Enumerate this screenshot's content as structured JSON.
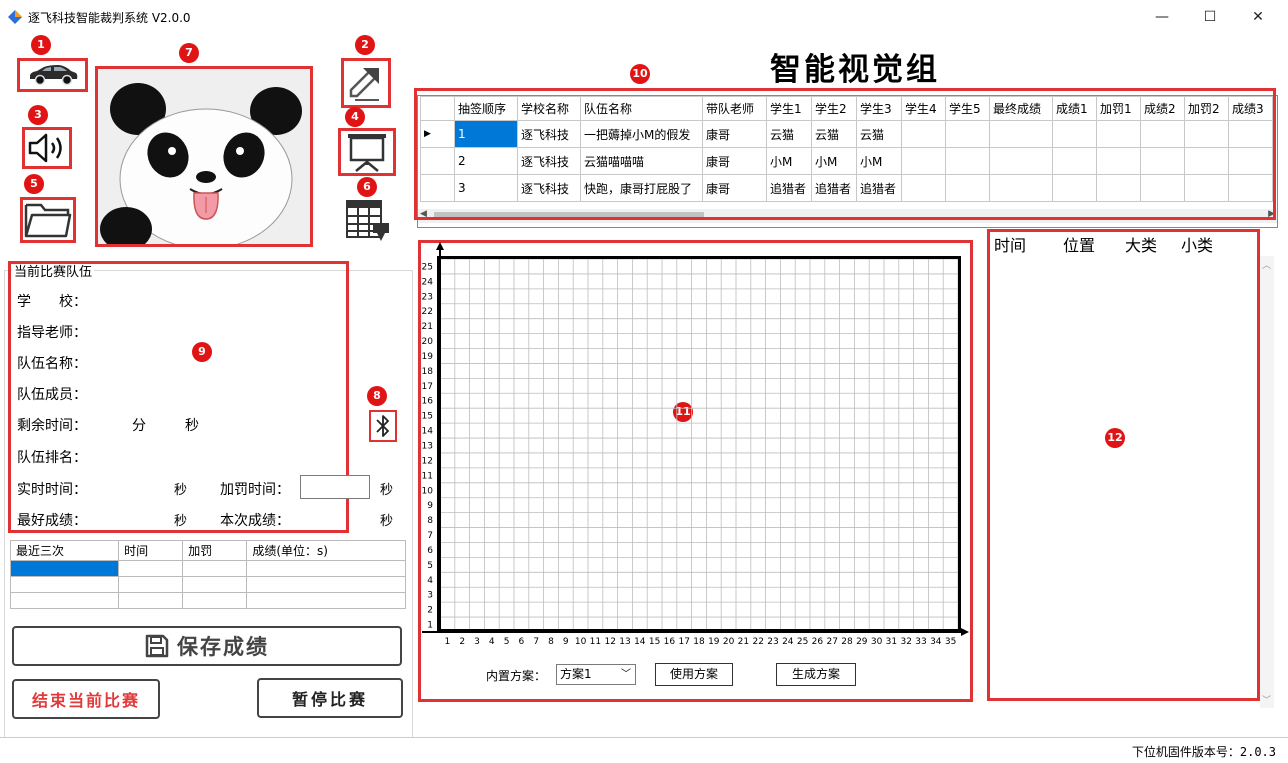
{
  "window": {
    "title": "逐飞科技智能裁判系统 V2.0.0",
    "minimize": "—",
    "maximize": "☐",
    "close": "✕"
  },
  "badges": [
    "1",
    "2",
    "3",
    "4",
    "5",
    "6",
    "7",
    "8",
    "9",
    "10",
    "11",
    "12"
  ],
  "heading": "智能视觉组",
  "team_table": {
    "headers": [
      "抽签顺序",
      "学校名称",
      "队伍名称",
      "带队老师",
      "学生1",
      "学生2",
      "学生3",
      "学生4",
      "学生5",
      "最终成绩",
      "成绩1",
      "加罚1",
      "成绩2",
      "加罚2",
      "成绩3"
    ],
    "rows": [
      [
        "1",
        "逐飞科技",
        "一把薅掉小M的假发",
        "康哥",
        "云猫",
        "云猫",
        "云猫",
        "",
        "",
        "",
        "",
        "",
        "",
        "",
        ""
      ],
      [
        "2",
        "逐飞科技",
        "云猫喵喵喵",
        "康哥",
        "小M",
        "小M",
        "小M",
        "",
        "",
        "",
        "",
        "",
        "",
        "",
        ""
      ],
      [
        "3",
        "逐飞科技",
        "快跑，康哥打屁股了",
        "康哥",
        "追猎者",
        "追猎者",
        "追猎者",
        "",
        "",
        "",
        "",
        "",
        "",
        "",
        ""
      ]
    ]
  },
  "current_team": {
    "group_title": "当前比赛队伍",
    "school_label": "学　　校：",
    "teacher_label": "指导老师：",
    "team_label": "队伍名称：",
    "members_label": "队伍成员：",
    "remaining_label": "剩余时间：",
    "minute_unit": "分",
    "second_unit": "秒",
    "rank_label": "队伍排名：",
    "realtime_label": "实时时间：",
    "penalty_time_label": "加罚时间：",
    "best_label": "最好成绩：",
    "this_label": "本次成绩："
  },
  "recent": {
    "headers": [
      "最近三次",
      "时间",
      "加罚",
      "成绩(单位：s)"
    ]
  },
  "buttons": {
    "save": "保存成绩",
    "end": "结束当前比赛",
    "pause": "暂停比赛",
    "use_plan": "使用方案",
    "gen_plan": "生成方案"
  },
  "plan": {
    "label": "内置方案：",
    "selected": "方案1"
  },
  "grid": {
    "x_ticks": [
      1,
      2,
      3,
      4,
      5,
      6,
      7,
      8,
      9,
      10,
      11,
      12,
      13,
      14,
      15,
      16,
      17,
      18,
      19,
      20,
      21,
      22,
      23,
      24,
      25,
      26,
      27,
      28,
      29,
      30,
      31,
      32,
      33,
      34,
      35
    ],
    "y_ticks": [
      1,
      2,
      3,
      4,
      5,
      6,
      7,
      8,
      9,
      10,
      11,
      12,
      13,
      14,
      15,
      16,
      17,
      18,
      19,
      20,
      21,
      22,
      23,
      24,
      25
    ]
  },
  "log": {
    "headers": [
      "时间",
      "位置",
      "大类",
      "小类"
    ]
  },
  "status": {
    "firmware": "下位机固件版本号：2.0.3"
  },
  "colors": {
    "annotation_red": "#e03232",
    "badge_red": "#e01414",
    "end_button_text": "#e03a3a",
    "selection_blue": "#0078d7"
  }
}
